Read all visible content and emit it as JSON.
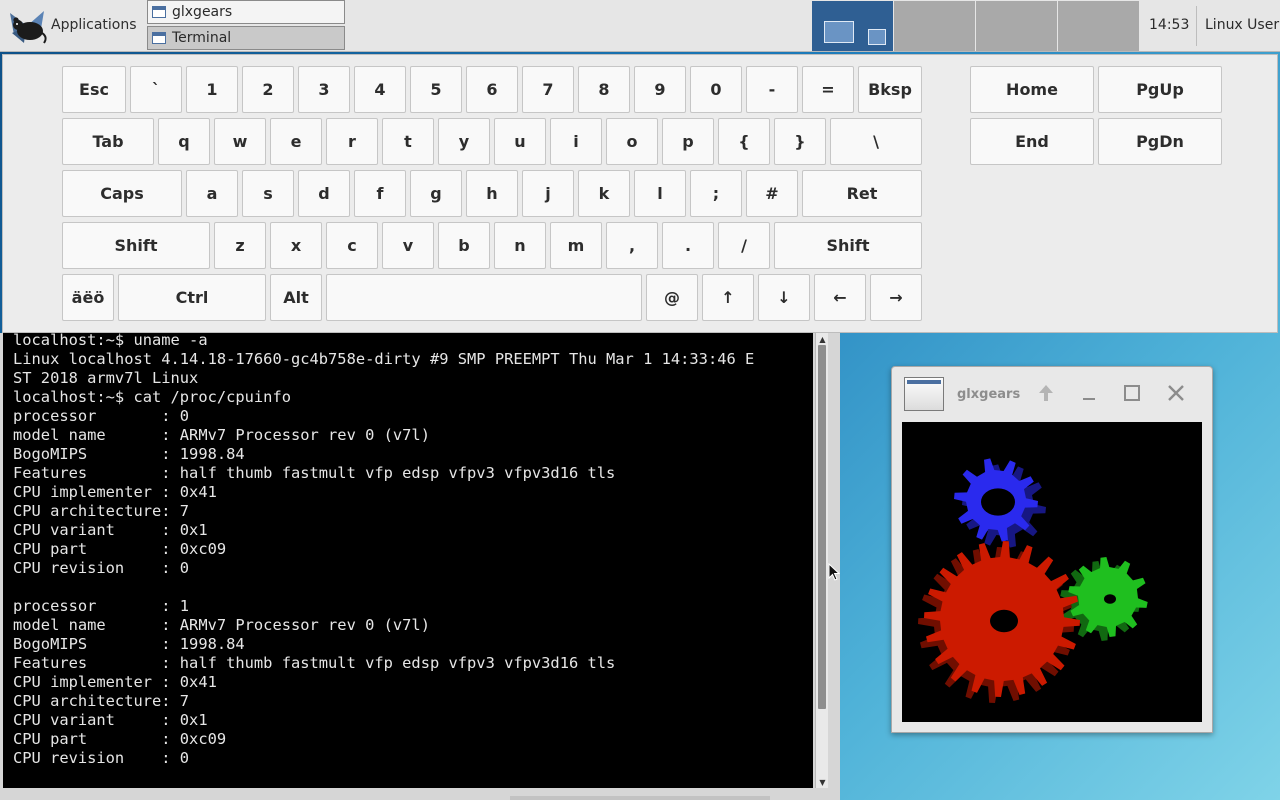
{
  "panel": {
    "applications_label": "Applications",
    "tasks": [
      {
        "label": "glxgears",
        "active": false
      },
      {
        "label": "Terminal",
        "active": true
      }
    ],
    "clock": "14:53",
    "user": "Linux User",
    "active_workspace": 1
  },
  "keyboard": {
    "rows": [
      [
        "Esc",
        "`",
        "1",
        "2",
        "3",
        "4",
        "5",
        "6",
        "7",
        "8",
        "9",
        "0",
        "-",
        "=",
        "Bksp"
      ],
      [
        "Tab",
        "q",
        "w",
        "e",
        "r",
        "t",
        "y",
        "u",
        "i",
        "o",
        "p",
        "{",
        "}",
        "\\"
      ],
      [
        "Caps",
        "a",
        "s",
        "d",
        "f",
        "g",
        "h",
        "j",
        "k",
        "l",
        ";",
        "#",
        "Ret"
      ],
      [
        "Shift",
        "z",
        "x",
        "c",
        "v",
        "b",
        "n",
        "m",
        ",",
        ".",
        "/",
        "Shift"
      ],
      [
        "äëö",
        "Ctrl",
        "Alt",
        "",
        "@",
        "↑",
        "↓",
        "←",
        "→"
      ]
    ],
    "nav": [
      "Home",
      "PgUp",
      "End",
      "PgDn"
    ]
  },
  "terminal": {
    "lines": [
      "localhost:~$ uname -a",
      "Linux localhost 4.14.18-17660-gc4b758e-dirty #9 SMP PREEMPT Thu Mar 1 14:33:46 E",
      "ST 2018 armv7l Linux",
      "localhost:~$ cat /proc/cpuinfo",
      "processor       : 0",
      "model name      : ARMv7 Processor rev 0 (v7l)",
      "BogoMIPS        : 1998.84",
      "Features        : half thumb fastmult vfp edsp vfpv3 vfpv3d16 tls",
      "CPU implementer : 0x41",
      "CPU architecture: 7",
      "CPU variant     : 0x1",
      "CPU part        : 0xc09",
      "CPU revision    : 0",
      "",
      "processor       : 1",
      "model name      : ARMv7 Processor rev 0 (v7l)",
      "BogoMIPS        : 1998.84",
      "Features        : half thumb fastmult vfp edsp vfpv3 vfpv3d16 tls",
      "CPU implementer : 0x41",
      "CPU architecture: 7",
      "CPU variant     : 0x1",
      "CPU part        : 0xc09",
      "CPU revision    : 0"
    ]
  },
  "glxgears_window": {
    "title": "glxgears",
    "gear_colors": {
      "red": "#cc1a00",
      "green": "#1fbf1f",
      "blue": "#2a2aee"
    }
  },
  "icons": {
    "apps": "xfce-mouse-icon",
    "window": "window-icon",
    "titlebar_buttons": [
      "arrow-up-icon",
      "minimize-icon",
      "maximize-icon",
      "close-icon"
    ]
  }
}
